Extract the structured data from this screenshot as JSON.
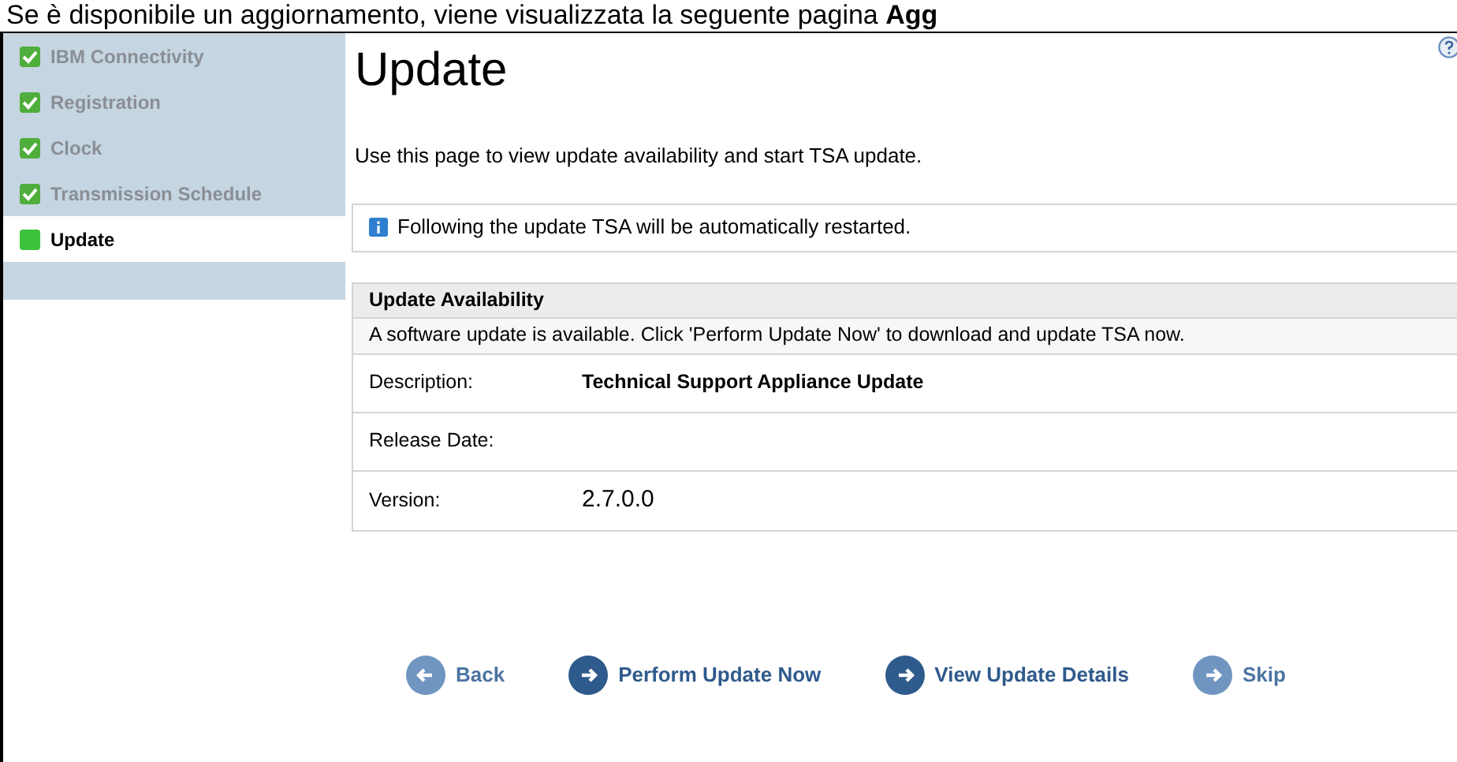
{
  "caption": {
    "text": "Se è disponibile un aggiornamento, viene visualizzata la seguente pagina",
    "bold_tail": "Agg"
  },
  "sidebar": {
    "items": [
      {
        "label": "IBM Connectivity",
        "done": true,
        "selected": false
      },
      {
        "label": "Registration",
        "done": true,
        "selected": false
      },
      {
        "label": "Clock",
        "done": true,
        "selected": false
      },
      {
        "label": "Transmission Schedule",
        "done": true,
        "selected": false
      },
      {
        "label": "Update",
        "done": false,
        "selected": true
      }
    ]
  },
  "page": {
    "title": "Update",
    "intro": "Use this page to view update availability and start TSA update.",
    "notice": "Following the update TSA will be automatically restarted."
  },
  "availability": {
    "heading": "Update Availability",
    "message": "A software update is available. Click 'Perform Update Now' to download and update TSA now.",
    "rows": [
      {
        "label": "Description:",
        "value": "Technical Support Appliance Update",
        "kind": "bold"
      },
      {
        "label": "Release Date:"
      },
      {
        "label": "Version:",
        "value": "2.7.0.0",
        "kind": "large"
      }
    ]
  },
  "buttons": [
    {
      "label": "Back",
      "kind": "back"
    },
    {
      "label": "Perform Update Now",
      "kind": "primary"
    },
    {
      "label": "View Update Details",
      "kind": "primary"
    },
    {
      "label": "Skip",
      "kind": "secondary"
    }
  ]
}
